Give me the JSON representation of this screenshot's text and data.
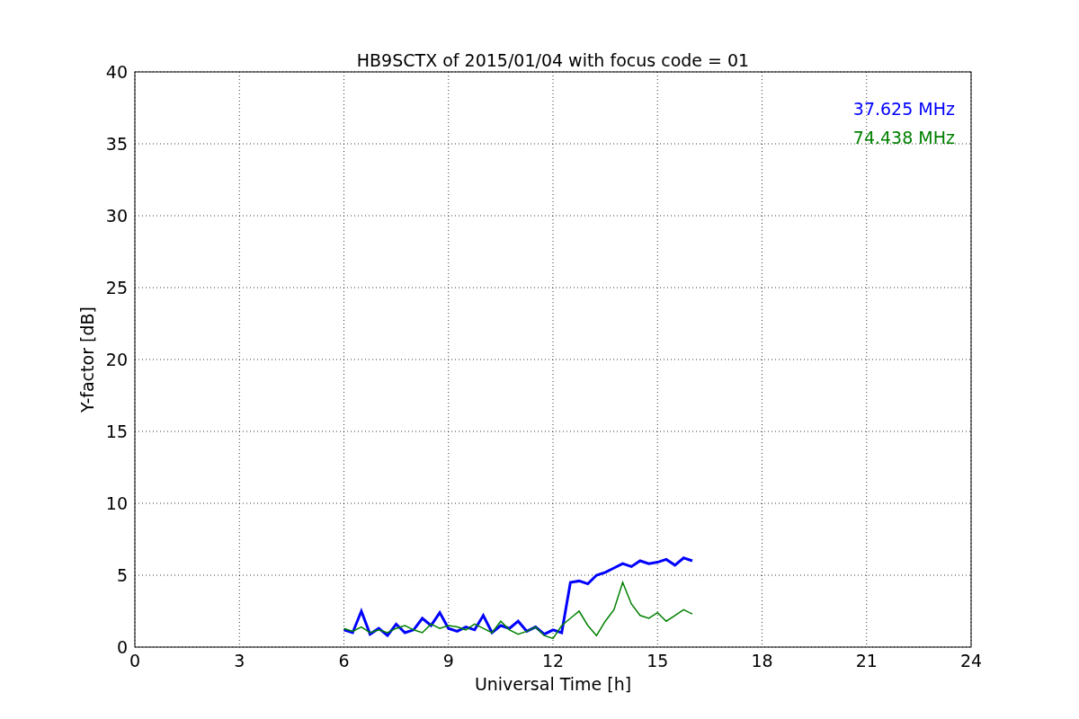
{
  "figure": {
    "chart_data": {
      "type": "line",
      "title": "HB9SCTX of 2015/01/04 with focus code = 01",
      "xlabel": "Universal Time [h]",
      "ylabel": "Y-factor [dB]",
      "x": [
        6,
        6.25,
        6.5,
        6.75,
        7,
        7.25,
        7.5,
        7.75,
        8,
        8.25,
        8.5,
        8.75,
        9,
        9.25,
        9.5,
        9.75,
        10,
        10.25,
        10.5,
        10.75,
        11,
        11.25,
        11.5,
        11.75,
        12,
        12.25,
        12.5,
        12.75,
        13,
        13.25,
        13.5,
        13.75,
        14,
        14.25,
        14.5,
        14.75,
        15,
        15.25,
        15.5,
        15.75,
        16
      ],
      "series": [
        {
          "name": "37.625 MHz",
          "color": "#0000ff",
          "values": [
            1.2,
            1.0,
            2.5,
            0.9,
            1.3,
            0.8,
            1.6,
            1.0,
            1.2,
            2.0,
            1.5,
            2.4,
            1.3,
            1.1,
            1.4,
            1.2,
            2.2,
            1.0,
            1.5,
            1.3,
            1.8,
            1.1,
            1.4,
            0.9,
            1.2,
            1.0,
            4.5,
            4.6,
            4.4,
            5.0,
            5.2,
            5.5,
            5.8,
            5.6,
            6.0,
            5.8,
            5.9,
            6.1,
            5.7,
            6.2,
            6.0
          ]
        },
        {
          "name": "74.438 MHz",
          "color": "#008000",
          "values": [
            1.3,
            1.1,
            1.4,
            1.0,
            1.2,
            1.0,
            1.3,
            1.5,
            1.2,
            1.0,
            1.6,
            1.3,
            1.5,
            1.4,
            1.2,
            1.6,
            1.3,
            1.0,
            1.8,
            1.2,
            0.9,
            1.1,
            1.4,
            0.8,
            0.6,
            1.5,
            2.0,
            2.5,
            1.5,
            0.8,
            1.8,
            2.6,
            4.5,
            3.0,
            2.2,
            2.0,
            2.4,
            1.8,
            2.2,
            2.6,
            2.3
          ]
        }
      ],
      "grid": true,
      "xlim": [
        0,
        24
      ],
      "ylim": [
        0,
        40
      ],
      "xticks": [
        0,
        3,
        6,
        9,
        12,
        15,
        18,
        21,
        24
      ],
      "yticks": [
        0,
        5,
        10,
        15,
        20,
        25,
        30,
        35,
        40
      ]
    }
  }
}
